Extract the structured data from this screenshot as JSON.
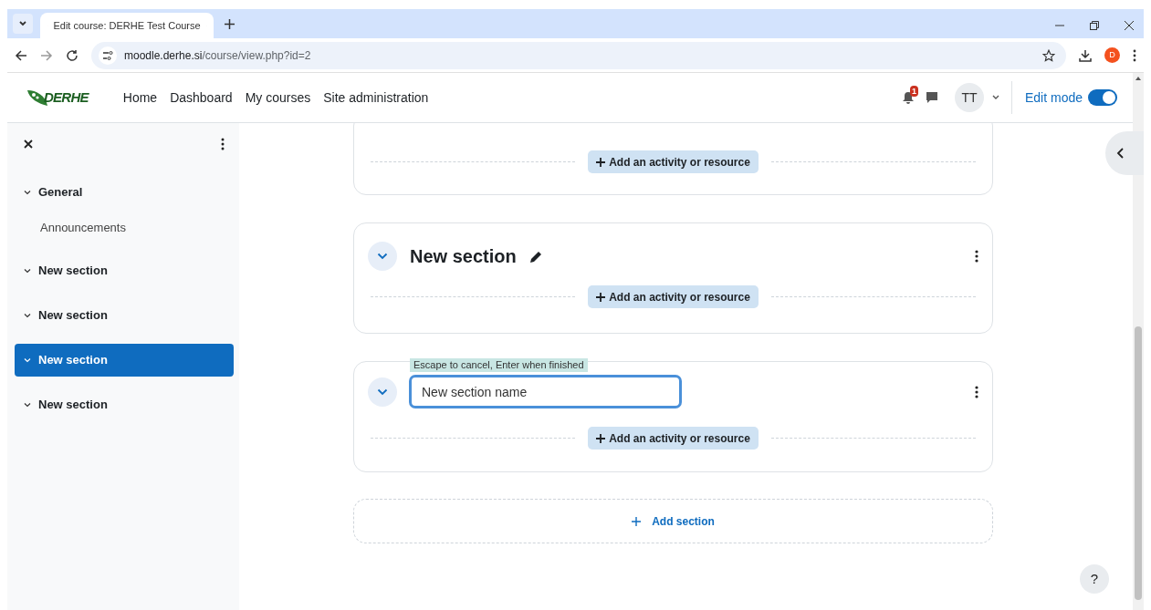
{
  "browser": {
    "tabs": [
      {
        "title": "Edit course: DERHE Test Course",
        "selected": true
      }
    ],
    "url_host": "moodle.derhe.si",
    "url_path": "/course/view.php?id=2",
    "profile": "D"
  },
  "navbar": {
    "logo": "DERHE",
    "links": [
      "Home",
      "Dashboard",
      "My courses",
      "Site administration"
    ],
    "notification_count": "1",
    "avatar": "TT",
    "edit_mode": {
      "label": "Edit mode",
      "on": true
    }
  },
  "drawer": {
    "items": [
      {
        "label": "General",
        "expanded": true,
        "selected": false,
        "children": [
          {
            "label": "Announcements",
            "selected": false
          }
        ]
      },
      {
        "label": "New section",
        "expanded": true,
        "selected": false
      },
      {
        "label": "New section",
        "expanded": true,
        "selected": false
      },
      {
        "label": "New section",
        "expanded": true,
        "selected": true
      },
      {
        "label": "New section",
        "expanded": true,
        "selected": false
      }
    ]
  },
  "sections": [
    {
      "kind": "partial",
      "add_button": "Add an activity or resource"
    },
    {
      "kind": "titled",
      "title": "New section",
      "add_button": "Add an activity or resource"
    },
    {
      "kind": "editing",
      "hint": "Escape to cancel, Enter when finished",
      "value": "New section name",
      "add_button": "Add an activity or resource"
    }
  ],
  "add_section": "Add section",
  "help": "?"
}
